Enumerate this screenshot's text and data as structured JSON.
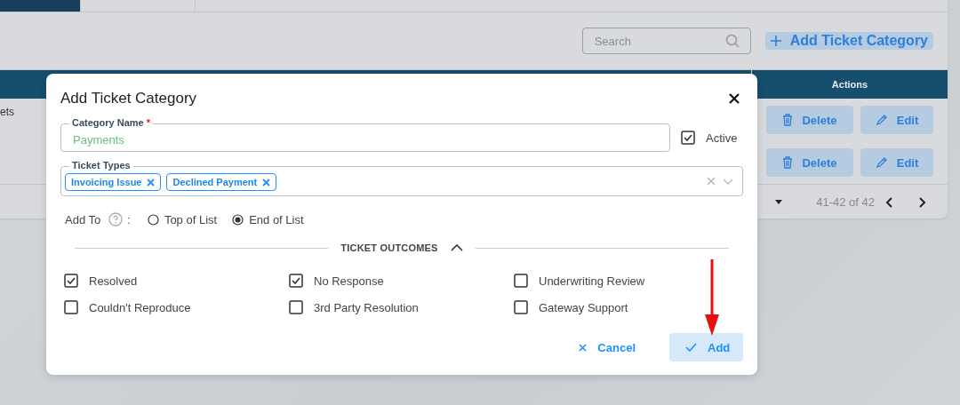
{
  "background_page": {
    "tabs": [
      {
        "selected": true
      },
      {
        "selected": false
      }
    ],
    "search": {
      "placeholder": "Search"
    },
    "add_button": "Add Ticket Category",
    "table": {
      "columns": [
        "Actions"
      ],
      "rows": [
        {
          "cell": "ets",
          "actions": [
            "Delete",
            "Edit"
          ]
        },
        {
          "actions": [
            "Delete",
            "Edit"
          ]
        }
      ]
    },
    "pagination": {
      "range": "41-42 of 42"
    }
  },
  "dialog": {
    "title": "Add Ticket Category",
    "category_name": {
      "label": "Category Name",
      "required_mark": "*",
      "value": "Payments"
    },
    "active": {
      "label": "Active",
      "checked": true
    },
    "ticket_types": {
      "label": "Ticket Types",
      "chips": [
        "Invoicing Issue",
        "Declined Payment"
      ]
    },
    "add_to": {
      "label": "Add To",
      "separator": ":",
      "options": [
        {
          "label": "Top of List",
          "selected": false
        },
        {
          "label": "End of List",
          "selected": true
        }
      ]
    },
    "outcomes_section": {
      "title": "TICKET OUTCOMES",
      "expanded": true
    },
    "outcomes": [
      {
        "label": "Resolved",
        "checked": true
      },
      {
        "label": "No Response",
        "checked": true
      },
      {
        "label": "Underwriting Review",
        "checked": false
      },
      {
        "label": "Couldn't Reproduce",
        "checked": false
      },
      {
        "label": "3rd Party Resolution",
        "checked": false
      },
      {
        "label": "Gateway Support",
        "checked": false
      }
    ],
    "buttons": {
      "cancel": "Cancel",
      "add": "Add"
    }
  }
}
